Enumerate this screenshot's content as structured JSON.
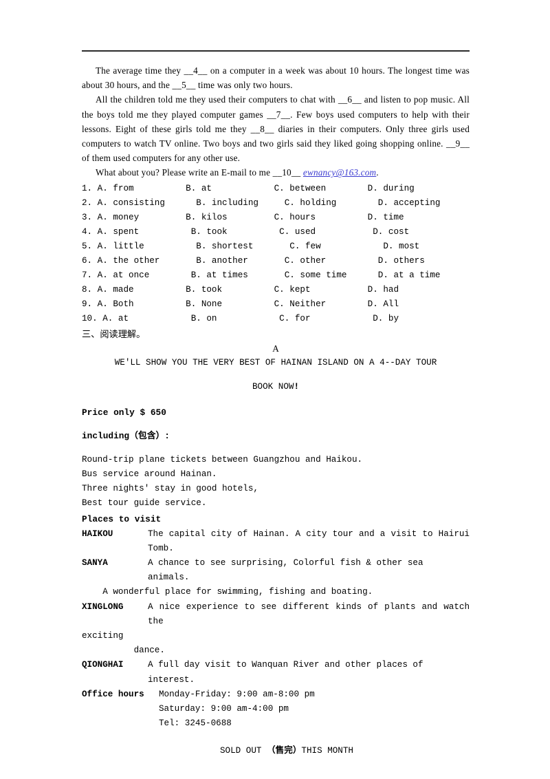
{
  "document": {
    "rule": "horizontal-rule",
    "cloze": {
      "paragraphs": [
        "The average time they __4__ on a computer in a week was about 10 hours. The longest time was about 30 hours, and the __5__ time was only two hours.",
        "All the children told me they used their computers to chat with __6__ and listen to pop music. All the boys told me they played computer games __7__. Few boys used computers to help with their lessons. Eight of these girls told me they __8__ diaries in their computers. Only three girls used computers to watch TV online. Two boys and two girls said they liked going shopping online. __9__ of them used computers for any other use."
      ],
      "final_paragraph": {
        "before_link": "What about you? Please write an E-mail to me __10__  ",
        "link_text": "ewnancy@163.com",
        "after_link": "."
      },
      "link_color": "#3a3ad0",
      "options": [
        "1. A. from          B. at            C. between        D. during",
        "2. A. consisting      B. including     C. holding        D. accepting",
        "3. A. money         B. kilos         C. hours          D. time",
        "4. A. spent          B. took          C. used           D. cost",
        "5. A. little          B. shortest       C. few            D. most",
        "6. A. the other       B. another       C. other          D. others",
        "7. A. at once        B. at times       C. some time      D. at a time",
        "8. A. made          B. took          C. kept           D. had",
        "9. A. Both          B. None          C. Neither        D. All",
        "10. A. at            B. on            C. for            D. by"
      ]
    },
    "section_heading": "三、阅读理解。",
    "passage": {
      "letter": "A",
      "headline": "WE'LL SHOW YOU THE VERY BEST OF HAINAN ISLAND ON A 4--DAY TOUR",
      "book_now": "BOOK NOW",
      "book_now_bang": "!",
      "price": "Price only $ 650",
      "including": "including（包含）:",
      "included_items": [
        "Round-trip plane tickets between Guangzhou and Haikou.",
        "Bus service around Hainan.",
        "Three nights' stay in good hotels,",
        "Best tour guide service."
      ],
      "places_heading": "Places to visit",
      "places": [
        {
          "name": "HAIKOU",
          "description": "The capital city of Hainan. A city tour and a visit to Hairui Tomb.",
          "continuation": ""
        },
        {
          "name": "SANYA",
          "description": "A  chance  to see surprising, Colorful fish & other sea animals.",
          "continuation": "    A wonderful place for swimming, fishing and boating."
        },
        {
          "name": "XINGLONG",
          "description": "A nice experience to see different kinds of plants and watch the",
          "continuation": "exciting",
          "continuation2": "          dance."
        },
        {
          "name": "QIONGHAI",
          "description": "A full day visit to Wanquan River and other places of interest.",
          "continuation": ""
        }
      ],
      "office": {
        "label": "Office hours",
        "lines": [
          "Monday-Friday: 9:00 am-8:00 pm",
          "Saturday: 9:00 am-4:00 pm",
          "Tel: 3245-0688"
        ]
      },
      "sold_out": {
        "prefix": "SOLD OUT ",
        "cjk": "（售完）",
        "suffix": "THIS MONTH"
      }
    }
  }
}
